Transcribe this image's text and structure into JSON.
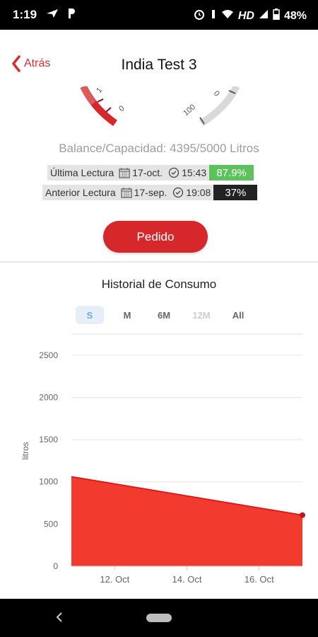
{
  "status_bar": {
    "time": "1:19",
    "left_icons": [
      "send-icon",
      "p-icon"
    ],
    "network": "HD",
    "battery": "48%"
  },
  "header": {
    "back_label": "Atrás",
    "title": "India Test 3"
  },
  "gauges": {
    "left_ticks": [
      "1",
      "0"
    ],
    "right_ticks": [
      "0",
      "100"
    ]
  },
  "balance_text": "Balance/Capacidad: 4395/5000 Litros",
  "readings": {
    "latest": {
      "label": "Última Lectura",
      "date": "17-oct.",
      "time": "15:43",
      "percent": "87.9%",
      "color": "#5cc25c"
    },
    "previous": {
      "label": "Anterior Lectura",
      "date": "17-sep.",
      "time": "19:08",
      "percent": "37%",
      "color": "#222222"
    }
  },
  "order_button": "Pedido",
  "chart_title": "Historial de Consumo",
  "range_tabs": [
    {
      "label": "S",
      "state": "active"
    },
    {
      "label": "M",
      "state": "normal"
    },
    {
      "label": "6M",
      "state": "normal"
    },
    {
      "label": "12M",
      "state": "disabled"
    },
    {
      "label": "All",
      "state": "normal"
    }
  ],
  "chart_data": {
    "type": "area",
    "ylabel": "litros",
    "ylim": [
      0,
      2750
    ],
    "yticks": [
      0,
      500,
      1000,
      1500,
      2000,
      2500
    ],
    "xticks": [
      {
        "label": "12. Oct",
        "day": 12
      },
      {
        "label": "14. Oct",
        "day": 14
      },
      {
        "label": "16. Oct",
        "day": 16
      }
    ],
    "xlim": [
      10.8,
      17.2
    ],
    "series": [
      {
        "color": "#f23a2f",
        "points": [
          {
            "day": 10.8,
            "value": 1060
          },
          {
            "day": 17.2,
            "value": 605
          }
        ]
      }
    ],
    "grid": true
  }
}
